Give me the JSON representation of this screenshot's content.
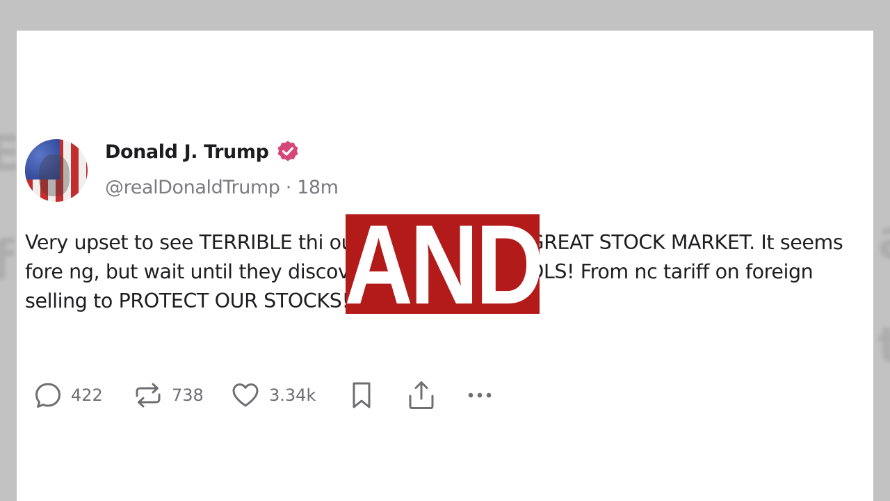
{
  "post": {
    "display_name": "Donald J. Trump",
    "meta": "@realDonaldTrump · 18m",
    "text": "Very upset to see TERRIBLE thi                      our BEAUTIFUL AND GREAT STOCK MARKET. It seems fore                         ng, but wait until they discover CAPITAL CONTROLS! From nc                       tariff on foreign selling to PROTECT OUR STOCKS!"
  },
  "actions": {
    "replies": "422",
    "retruths": "738",
    "likes": "3.34k"
  },
  "overlay": {
    "text": "AND"
  },
  "colors": {
    "background": "#c2c2c2",
    "card": "#ffffff",
    "verified_badge": "#d4477a",
    "overlay": "#b31b1b",
    "icon": "#6e6e73"
  },
  "icons": [
    "verified-badge-icon",
    "reply-icon",
    "retruth-icon",
    "heart-icon",
    "bookmark-icon",
    "share-icon",
    "more-icon"
  ]
}
